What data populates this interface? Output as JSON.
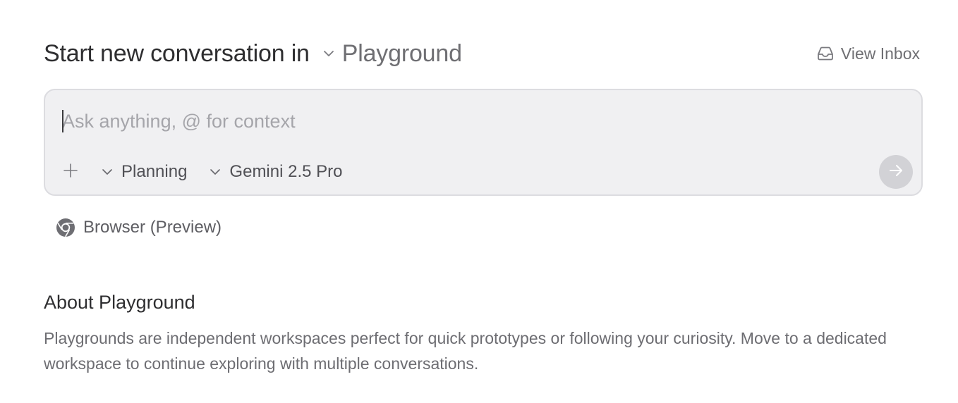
{
  "header": {
    "title": "Start new conversation in",
    "workspace": "Playground",
    "view_inbox_label": "View Inbox",
    "inbox_icon": "inbox-icon"
  },
  "prompt": {
    "value": "",
    "placeholder": "Ask anything, @ for context",
    "add_icon": "plus-icon",
    "mode_label": "Planning",
    "model_label": "Gemini 2.5 Pro",
    "send_icon": "arrow-right-icon"
  },
  "browser": {
    "label": "Browser (Preview)",
    "icon": "chrome-icon"
  },
  "about": {
    "title": "About Playground",
    "text": "Playgrounds are independent workspaces perfect for quick prototypes or following your curiosity. Move to a dedicated workspace to continue exploring with multiple conversations."
  },
  "colors": {
    "background": "#ffffff",
    "prompt_background": "#f0f0f2",
    "prompt_border": "#dcdce0",
    "send_button_disabled": "#d2d2d6",
    "muted_text": "#6f6f73"
  }
}
